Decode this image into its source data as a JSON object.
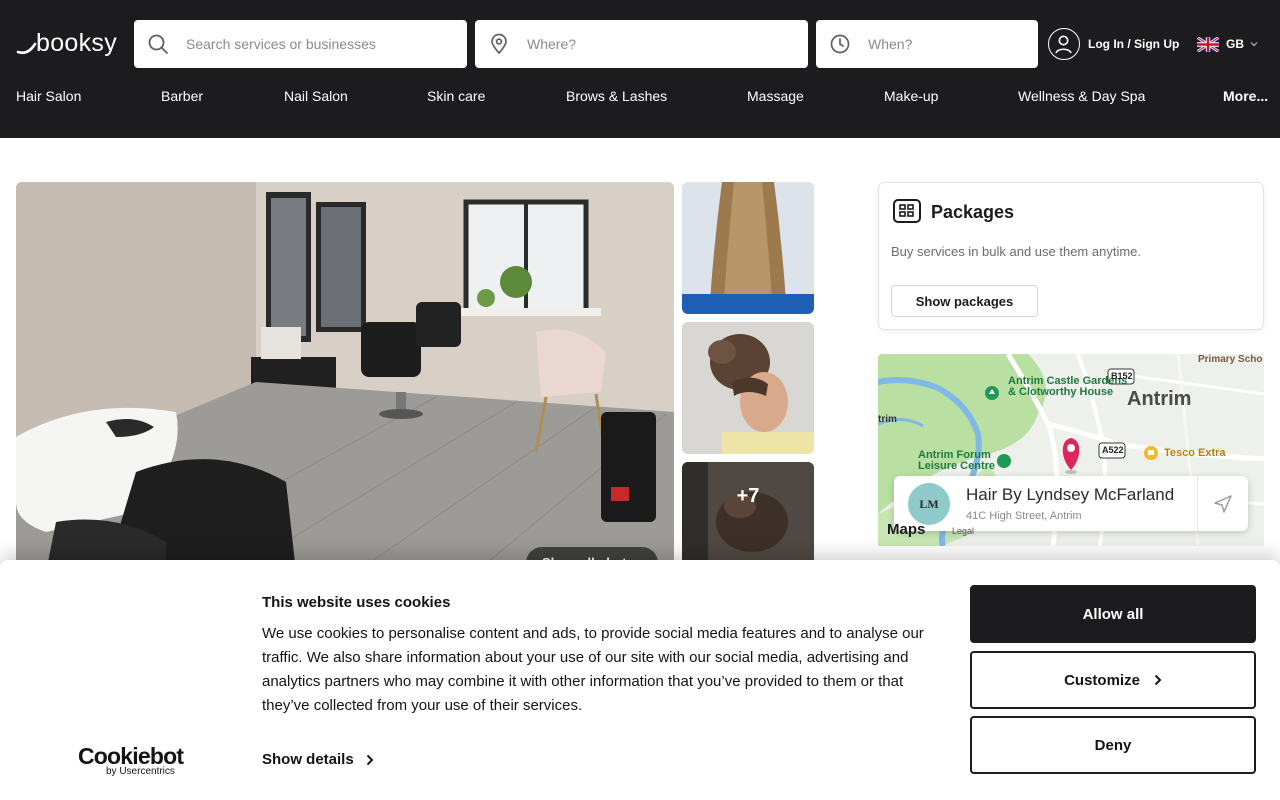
{
  "brand": {
    "logo_text": "booksy"
  },
  "search": {
    "services_placeholder": "Search services or businesses",
    "where_placeholder": "Where?",
    "when_placeholder": "When?"
  },
  "account": {
    "login_label": "Log In / Sign Up"
  },
  "language": {
    "code": "GB"
  },
  "nav": {
    "items": [
      "Hair Salon",
      "Barber",
      "Nail Salon",
      "Skin care",
      "Brows & Lashes",
      "Massage",
      "Make-up",
      "Wellness & Day Spa"
    ],
    "more_label": "More..."
  },
  "gallery": {
    "more_count": "+7",
    "show_all_label": "Show all photos"
  },
  "packages": {
    "title": "Packages",
    "description": "Buy services in bulk and use them anytime.",
    "button_label": "Show packages"
  },
  "map": {
    "labels": {
      "town": "Antrim",
      "park": "Antrim Castle Gardens & Clotworthy House",
      "leisure": "Antrim Forum Leisure Centre",
      "store": "Tesco Extra",
      "school": "Primary Scho",
      "road_b152": "B152",
      "road_a522": "A522",
      "edge_left": "trim"
    },
    "attribution": "Maps",
    "legal": "Legal"
  },
  "business": {
    "name": "Hair By Lyndsey McFarland",
    "address": "41C High Street, Antrim",
    "logo_initials": "LM"
  },
  "cookie_banner": {
    "provider_logo": "Cookiebot",
    "provider_sub": "by Usercentrics",
    "title": "This website uses cookies",
    "body": "We use cookies to personalise content and ads, to provide social media features and to analyse our traffic. We also share information about your use of our site with our social media, advertising and analytics partners who may combine it with other information that you’ve provided to them or that they’ve collected from your use of their services.",
    "show_details_label": "Show details",
    "allow_all_label": "Allow all",
    "customize_label": "Customize",
    "deny_label": "Deny"
  },
  "colors": {
    "header_bg": "#1c1c1e",
    "map_pin": "#e0245e",
    "park_green": "#1d9a55",
    "store_yellow": "#f2b830"
  }
}
